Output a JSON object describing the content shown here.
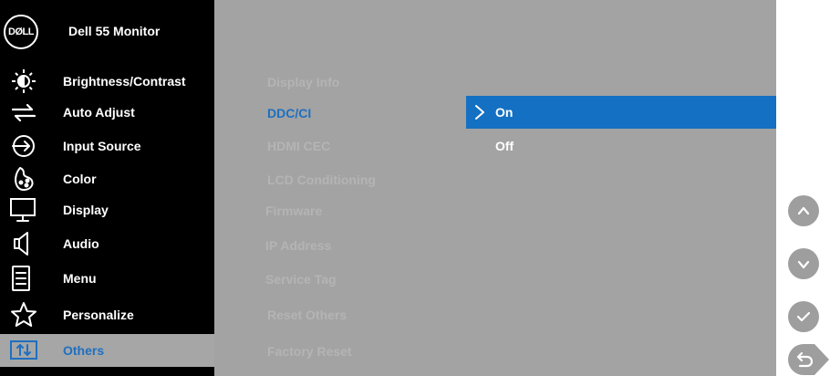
{
  "header": {
    "logo_text": "DØLL",
    "title": "Dell 55 Monitor"
  },
  "menu": {
    "items": [
      {
        "label": "Brightness/Contrast",
        "icon": "brightness-icon"
      },
      {
        "label": "Auto Adjust",
        "icon": "auto-adjust-icon"
      },
      {
        "label": "Input Source",
        "icon": "input-source-icon"
      },
      {
        "label": "Color",
        "icon": "color-icon"
      },
      {
        "label": "Display",
        "icon": "display-icon"
      },
      {
        "label": "Audio",
        "icon": "speaker-icon"
      },
      {
        "label": "Menu",
        "icon": "menu-icon"
      },
      {
        "label": "Personalize",
        "icon": "star-icon"
      },
      {
        "label": "Others",
        "icon": "others-icon",
        "active": true
      }
    ]
  },
  "submenu": {
    "items": [
      {
        "label": "Display Info"
      },
      {
        "label": "DDC/CI",
        "selected": true
      },
      {
        "label": "HDMI CEC"
      },
      {
        "label": "LCD Conditioning"
      },
      {
        "label": "Firmware"
      },
      {
        "label": "IP Address"
      },
      {
        "label": "Service Tag"
      },
      {
        "label": "Reset Others"
      },
      {
        "label": "Factory Reset"
      }
    ]
  },
  "options": {
    "items": [
      {
        "label": "On",
        "selected": true
      },
      {
        "label": "Off"
      }
    ]
  },
  "buttons": {
    "up": "chevron-up-icon",
    "down": "chevron-down-icon",
    "confirm": "checkmark-icon",
    "back": "back-arrow-icon"
  },
  "colors": {
    "menu_background": "#000000",
    "content_background": "#a3a3a3",
    "highlight_blue": "#1470c2",
    "active_menu_background": "#a6a6a6"
  }
}
